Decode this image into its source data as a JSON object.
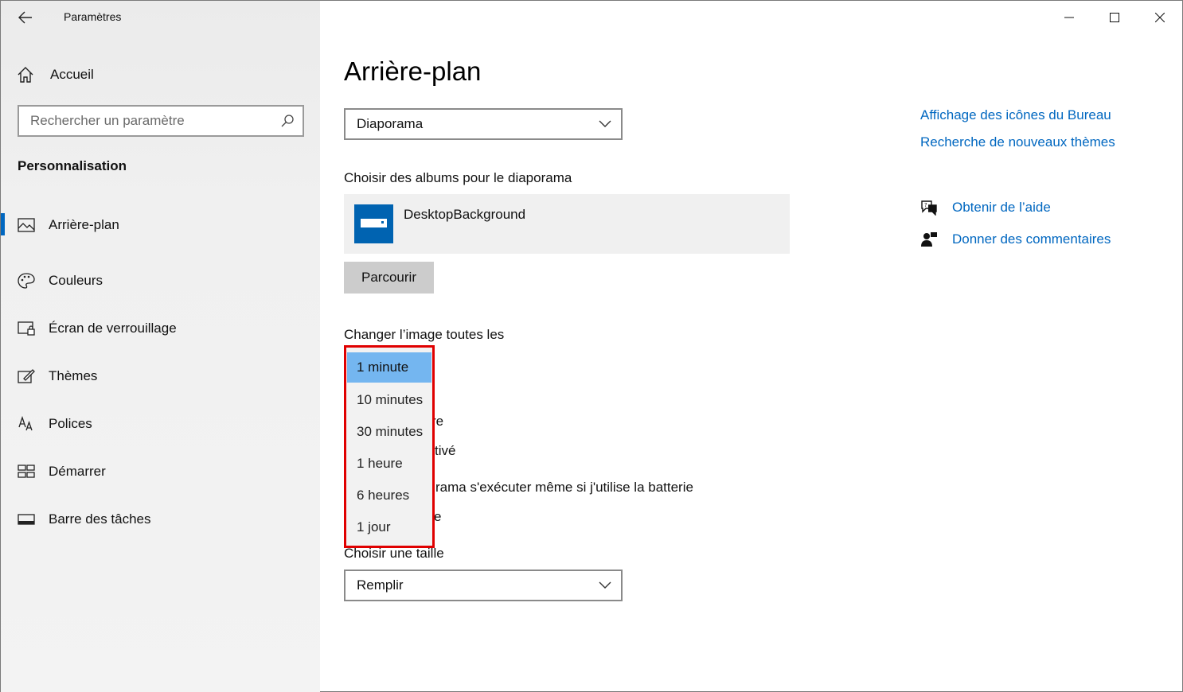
{
  "app": {
    "title": "Paramètres"
  },
  "sidebar": {
    "home": "Accueil",
    "search_placeholder": "Rechercher un paramètre",
    "section": "Personnalisation",
    "items": [
      {
        "label": "Arrière-plan",
        "icon": "picture-icon",
        "active": true
      },
      {
        "label": "Couleurs",
        "icon": "palette-icon"
      },
      {
        "label": "Écran de verrouillage",
        "icon": "lock-screen-icon"
      },
      {
        "label": "Thèmes",
        "icon": "themes-icon"
      },
      {
        "label": "Polices",
        "icon": "fonts-icon"
      },
      {
        "label": "Démarrer",
        "icon": "start-icon"
      },
      {
        "label": "Barre des tâches",
        "icon": "taskbar-icon"
      }
    ]
  },
  "main": {
    "title": "Arrière-plan",
    "background_type": "Diaporama",
    "albums_label": "Choisir des albums pour le diaporama",
    "album_name": "DesktopBackground",
    "browse_label": "Parcourir",
    "interval_label": "Changer l’image toutes les",
    "interval_options": [
      "1 minute",
      "10 minutes",
      "30 minutes",
      "1 heure",
      "6 heures",
      "1 jour"
    ],
    "obscured_1": "re",
    "obscured_2": "tivé",
    "obscured_3": "rama s'exécuter même si j'utilise la batterie",
    "obscured_4": "e",
    "size_label": "Choisir une taille",
    "size_value": "Remplir"
  },
  "related": {
    "link1": "Affichage des icônes du Bureau",
    "link2": "Recherche de nouveaux thèmes",
    "help": "Obtenir de l’aide",
    "feedback": "Donner des commentaires"
  },
  "colors": {
    "accent": "#0067c0",
    "selection": "#74b6f0",
    "highlight_border": "#e00000"
  }
}
